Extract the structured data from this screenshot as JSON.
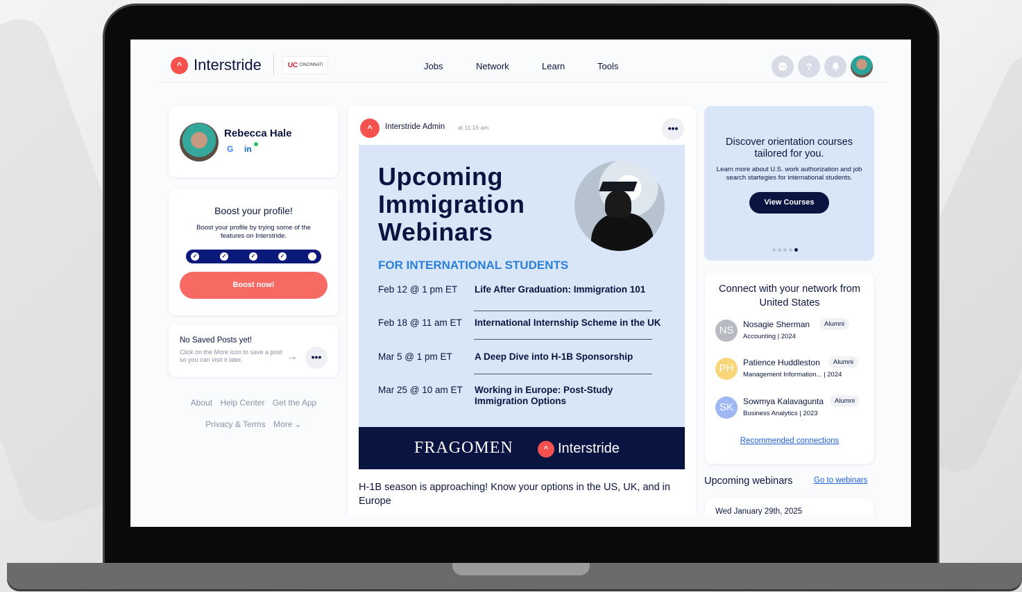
{
  "brand": {
    "name": "Interstride",
    "logo_glyph": "^",
    "university": "CINCINNATI",
    "university_mark": "UC",
    "accent": "#f5514f",
    "navy": "#0a1440"
  },
  "nav": {
    "items": [
      "Jobs",
      "Network",
      "Learn",
      "Tools"
    ],
    "icons": [
      "chat-icon",
      "help-icon",
      "bell-icon",
      "avatar"
    ],
    "help_glyph": "?"
  },
  "profile": {
    "name": "Rebecca Hale",
    "google": "G",
    "linkedin": "in"
  },
  "boost": {
    "title": "Boost your profile!",
    "text": "Boost your profile by trying some of the features on Interstride.",
    "check": "✓",
    "steps_completed": 4,
    "steps_total": 5,
    "button": "Boost now!"
  },
  "saved": {
    "title": "No Saved Posts yet!",
    "text": "Click on the More icon to save a post so you can visit it later.",
    "arrow": "→",
    "more": "•••"
  },
  "footer": {
    "links": [
      "About",
      "Help Center",
      "Get the App",
      "Privacy & Terms",
      "More ⌄"
    ]
  },
  "post": {
    "author": "Interstride Admin",
    "time": "at 11:16 am",
    "more": "•••",
    "banner": {
      "title_lines": [
        "Upcoming",
        "Immigration",
        "Webinars"
      ],
      "subtitle": "FOR INTERNATIONAL STUDENTS",
      "webinars": [
        {
          "date": "Feb 12 @ 1 pm ET",
          "title": "Life After Graduation: Immigration 101"
        },
        {
          "date": "Feb 18 @ 11 am ET",
          "title": "International Internship Scheme in the UK"
        },
        {
          "date": "Mar 5 @ 1 pm ET",
          "title": "A Deep Dive into H-1B Sponsorship"
        },
        {
          "date": "Mar 25 @ 10 am ET",
          "title": "Working in Europe: Post-Study Immigration Options"
        }
      ],
      "partner": "FRAGOMEN",
      "brand": "Interstride"
    },
    "text": "H-1B season is approaching! Know your options in the US, UK, and in Europe"
  },
  "promo": {
    "title": "Discover orientation courses tailored for you.",
    "text": "Learn more about U.S. work authorization and job search startegies for international students.",
    "button": "View Courses",
    "slides": 5,
    "active_slide": 5
  },
  "connect": {
    "title": "Connect with your network from United States",
    "people": [
      {
        "initials": "NS",
        "name": "Nosagie Sherman",
        "badge": "Alumni",
        "details": "Accounting  |  2024",
        "color": "#b8bac2"
      },
      {
        "initials": "PH",
        "name": "Patience Huddleston",
        "badge": "Alumni",
        "details": "Management Information...  |  2024",
        "color": "#f7d77a"
      },
      {
        "initials": "SK",
        "name": "Sowmya Kalavagunta",
        "badge": "Alumni",
        "details": "Business Analytics  |  2023",
        "color": "#9fb7f2"
      }
    ],
    "recommended": "Recommended connections"
  },
  "webinars": {
    "title": "Upcoming webinars",
    "link": "Go to webinars",
    "first_date": "Wed January 29th, 2025"
  }
}
